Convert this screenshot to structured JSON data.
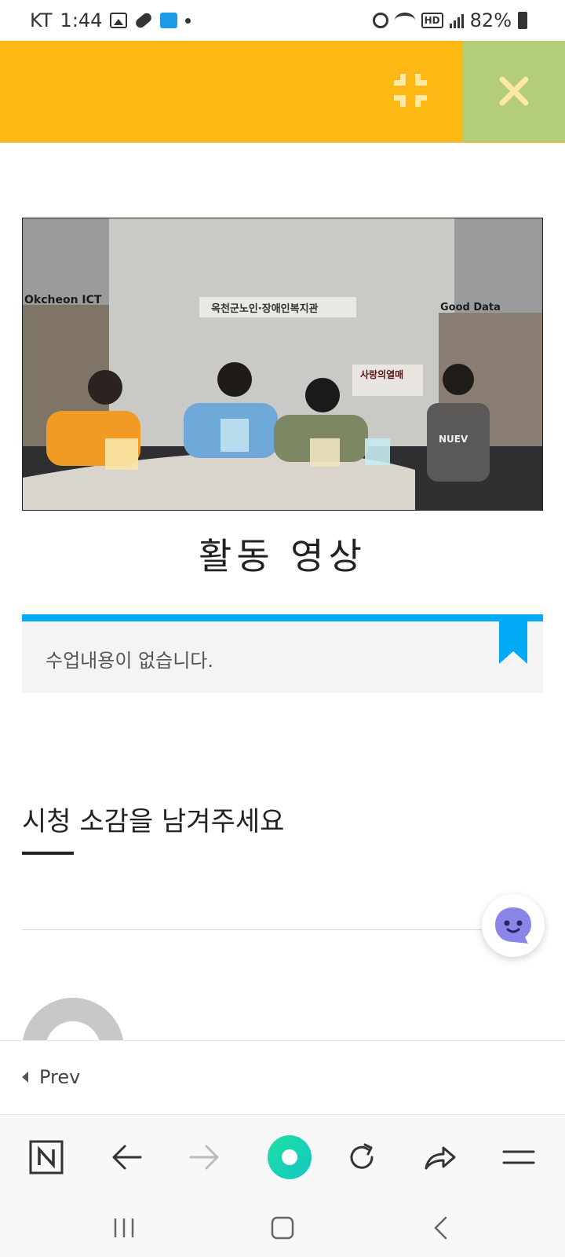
{
  "status_bar": {
    "carrier": "KT",
    "time": "1:44",
    "battery": "82%",
    "hd_label": "HD"
  },
  "header": {
    "shrink_icon": "shrink-icon",
    "close_icon": "close-icon",
    "colors": {
      "bar": "#fdb813",
      "close_bg": "#b3cd7a"
    }
  },
  "photo": {
    "sign_left": "Okcheon ICT",
    "sign_center": "옥천군노인·장애인복지관",
    "sign_right": "Good Data",
    "sign_poster": "사랑의열매",
    "shirt_text": "NUEV"
  },
  "main": {
    "title": "활동 영상",
    "notice": "수업내용이 없습니다.",
    "feedback_title": "시청 소감을 남겨주세요",
    "accent": "#02a9f4"
  },
  "pager": {
    "prev_label": "Prev"
  },
  "toolbar": {
    "items": [
      "naver-n-icon",
      "back-arrow-icon",
      "forward-arrow-icon",
      "green-dot-icon",
      "refresh-icon",
      "share-icon",
      "menu-icon"
    ]
  },
  "nav": {
    "items": [
      "recent-apps-icon",
      "home-icon",
      "back-icon"
    ]
  }
}
